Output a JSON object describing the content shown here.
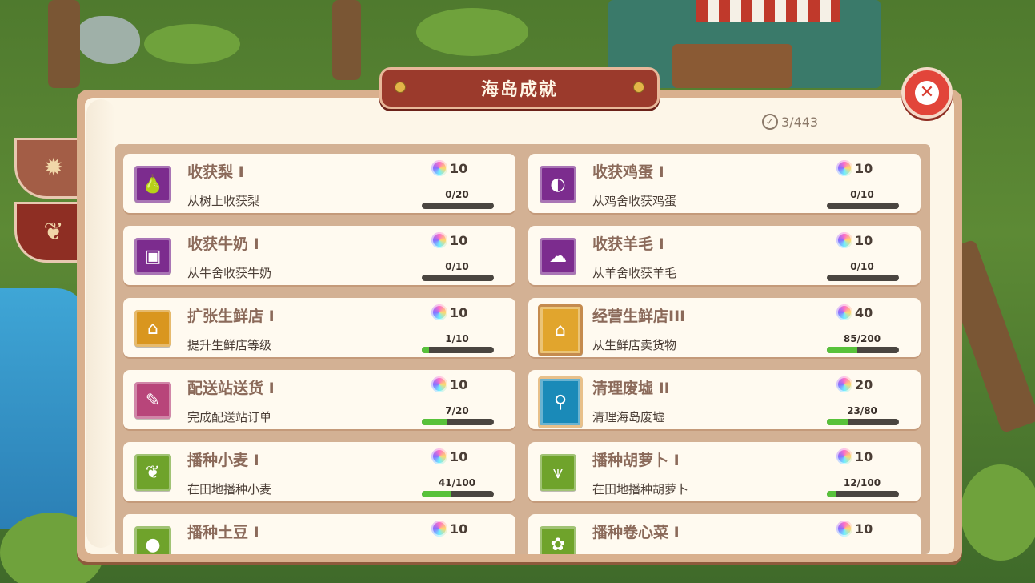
{
  "title": "海岛成就",
  "counter": "3/443",
  "colors": {
    "panel": "#d9b08e",
    "banner": "#9b3a2c",
    "progress": "#58c23a"
  },
  "side_tabs": [
    {
      "icon": "sun-badge-icon",
      "active": false
    },
    {
      "icon": "wheat-badge-icon",
      "active": true
    }
  ],
  "achievements": [
    {
      "title": "收获梨 I",
      "desc": "从树上收获梨",
      "reward": "10",
      "progress_text": "0/20",
      "progress": 0.0,
      "icon": "pear-icon",
      "frame": "purple"
    },
    {
      "title": "收获鸡蛋 I",
      "desc": "从鸡舍收获鸡蛋",
      "reward": "10",
      "progress_text": "0/10",
      "progress": 0.0,
      "icon": "egg-icon",
      "frame": "purple"
    },
    {
      "title": "收获牛奶 I",
      "desc": "从牛舍收获牛奶",
      "reward": "10",
      "progress_text": "0/10",
      "progress": 0.0,
      "icon": "milk-icon",
      "frame": "purple"
    },
    {
      "title": "收获羊毛 I",
      "desc": "从羊舍收获羊毛",
      "reward": "10",
      "progress_text": "0/10",
      "progress": 0.0,
      "icon": "wool-icon",
      "frame": "purple"
    },
    {
      "title": "扩张生鲜店 I",
      "desc": "提升生鲜店等级",
      "reward": "10",
      "progress_text": "1/10",
      "progress": 0.1,
      "icon": "shop-upgrade-icon",
      "frame": "orange"
    },
    {
      "title": "经营生鲜店III",
      "desc": "从生鲜店卖货物",
      "reward": "40",
      "progress_text": "85/200",
      "progress": 0.425,
      "icon": "shop-coins-icon",
      "frame": "gold"
    },
    {
      "title": "配送站送货 I",
      "desc": "完成配送站订单",
      "reward": "10",
      "progress_text": "7/20",
      "progress": 0.35,
      "icon": "delivery-ticket-icon",
      "frame": "pink"
    },
    {
      "title": "清理废墟 II",
      "desc": "清理海岛废墟",
      "reward": "20",
      "progress_text": "23/80",
      "progress": 0.2875,
      "icon": "broom-icon",
      "frame": "teal"
    },
    {
      "title": "播种小麦 I",
      "desc": "在田地播种小麦",
      "reward": "10",
      "progress_text": "41/100",
      "progress": 0.41,
      "icon": "wheat-icon",
      "frame": "green"
    },
    {
      "title": "播种胡萝卜 I",
      "desc": "在田地播种胡萝卜",
      "reward": "10",
      "progress_text": "12/100",
      "progress": 0.12,
      "icon": "carrot-icon",
      "frame": "green"
    },
    {
      "title": "播种土豆 I",
      "desc": "",
      "reward": "10",
      "progress_text": "",
      "progress": 0.0,
      "icon": "potato-icon",
      "frame": "green"
    },
    {
      "title": "播种卷心菜 I",
      "desc": "",
      "reward": "10",
      "progress_text": "",
      "progress": 0.0,
      "icon": "cabbage-icon",
      "frame": "green"
    }
  ]
}
